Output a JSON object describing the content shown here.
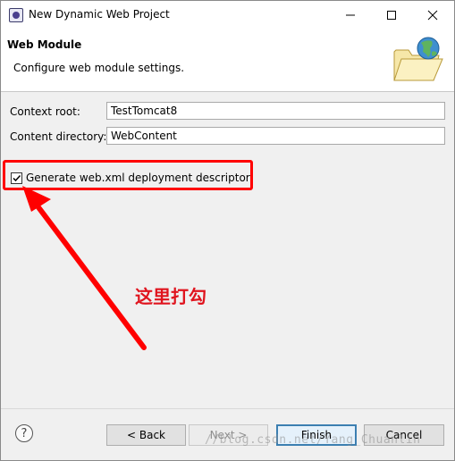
{
  "window": {
    "title": "New Dynamic Web Project",
    "controls": {
      "minimize": "minimize",
      "maximize": "maximize",
      "close": "close"
    }
  },
  "banner": {
    "title": "Web Module",
    "description": "Configure web module settings.",
    "image": "folder-globe-icon"
  },
  "form": {
    "context_root": {
      "label": "Context root:",
      "value": "TestTomcat8"
    },
    "content_directory": {
      "label": "Content directory:",
      "value": "WebContent"
    },
    "generate_xml": {
      "label": "Generate web.xml deployment descriptor",
      "checked": true
    }
  },
  "annotation": {
    "text": "这里打勾",
    "color": "#e0141e"
  },
  "footer": {
    "help": "?",
    "back": "< Back",
    "next": "Next >",
    "finish": "Finish",
    "cancel": "Cancel"
  },
  "watermark": "//blog.csdn.net/Yang_Chuanlin"
}
